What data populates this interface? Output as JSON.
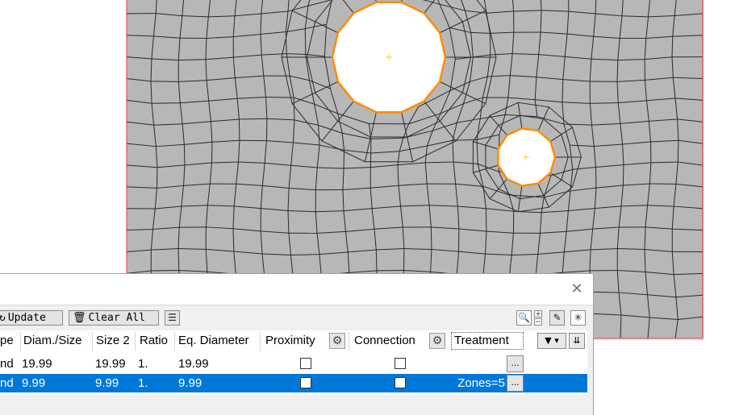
{
  "colors": {
    "mesh_fill": "#b7b7b7",
    "mesh_line": "#2a2a2a",
    "hole_edge": "#ff8c00",
    "hole_edge_inner": "#ffd400",
    "boundary": "#ff3030",
    "selection": "#0078d7"
  },
  "toolbar": {
    "update_label": "Update",
    "clear_all_label": "Clear All",
    "update_icon": "refresh-icon",
    "clear_icon": "trash-icon",
    "menu_icon": "hamburger-icon"
  },
  "table": {
    "headers": [
      "pe",
      "Diam./Size",
      "Size 2",
      "Ratio",
      "Eq. Diameter",
      "Proximity",
      "Connection",
      "Treatment"
    ],
    "rows": [
      {
        "type": "nd",
        "diam": "19.99",
        "size2": "19.99",
        "ratio": "1.",
        "eq": "19.99",
        "proximity": false,
        "connection": false,
        "treatment": "",
        "selected": false
      },
      {
        "type": "nd",
        "diam": "9.99",
        "size2": "9.99",
        "ratio": "1.",
        "eq": "9.99",
        "proximity": false,
        "connection": false,
        "treatment": "Zones=5",
        "selected": true
      }
    ],
    "dots_label": "..."
  },
  "icons": {
    "close": "close-icon",
    "zoom": "zoom-icon",
    "eraser": "eraser-icon",
    "explode": "explode-icon",
    "filter": "filter-icon",
    "sort": "sort-icon",
    "gear": "gear-icon"
  }
}
